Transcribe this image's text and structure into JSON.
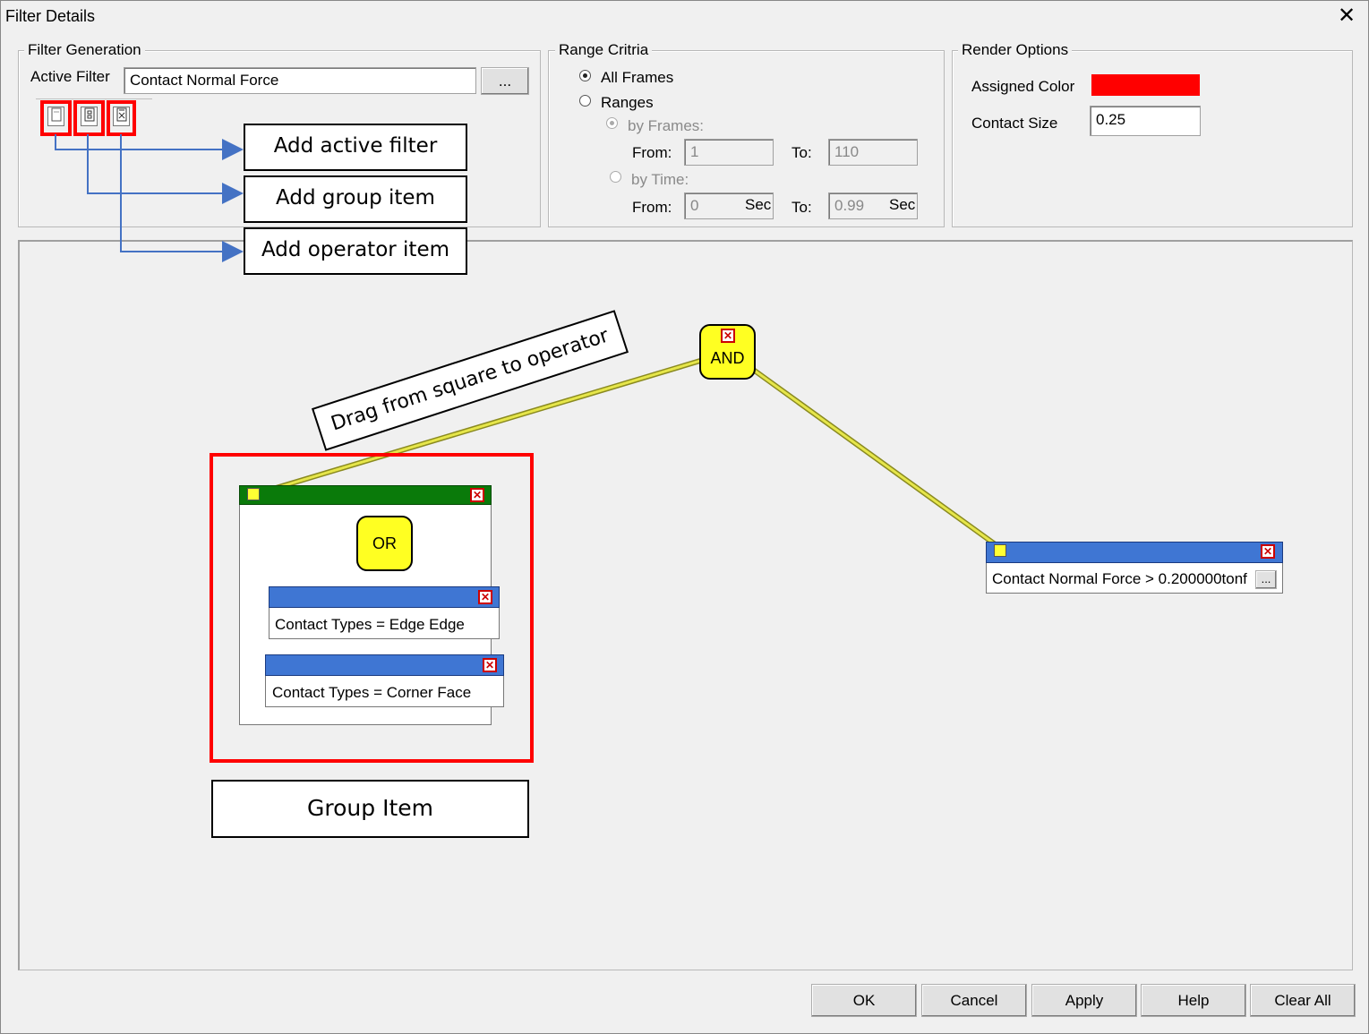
{
  "window": {
    "title": "Filter Details",
    "close_glyph": "✕"
  },
  "filter_generation": {
    "legend": "Filter Generation",
    "active_filter_label": "Active Filter",
    "active_filter_value": "Contact Normal Force",
    "browse_label": "...",
    "icons": [
      "add-filter-icon",
      "add-group-icon",
      "add-operator-icon"
    ]
  },
  "range_criteria": {
    "legend": "Range Critria",
    "all_frames": "All Frames",
    "ranges": "Ranges",
    "by_frames": "by Frames:",
    "from_label": "From:",
    "to_label": "To:",
    "frames_from": "1",
    "frames_to": "110",
    "by_time": "by Time:",
    "time_from": "0",
    "time_to": "0.99",
    "sec": "Sec",
    "selected": "All Frames"
  },
  "render_options": {
    "legend": "Render Options",
    "assigned_color_label": "Assigned Color",
    "assigned_color": "#ff0000",
    "contact_size_label": "Contact Size",
    "contact_size": "0.25"
  },
  "callouts": {
    "add_active_filter": "Add active filter",
    "add_group_item": "Add group item",
    "add_operator_item": "Add operator item",
    "drag_hint": "Drag from square to operator",
    "group_item": "Group Item"
  },
  "canvas": {
    "and_operator": "AND",
    "or_operator": "OR",
    "group_filters": [
      "Contact Types = Edge Edge",
      "Contact Types = Corner Face"
    ],
    "standalone_filter": "Contact Normal Force > 0.200000tonf",
    "filter_browse": "...",
    "link_color": "#c8c832",
    "callout_arrow_color": "#4472c4"
  },
  "buttons": {
    "ok": "OK",
    "cancel": "Cancel",
    "apply": "Apply",
    "help": "Help",
    "clear_all": "Clear All"
  }
}
